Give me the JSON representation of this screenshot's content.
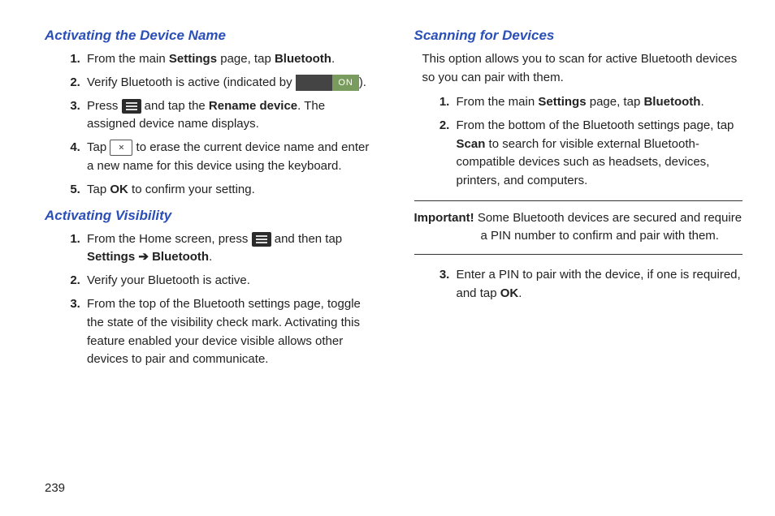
{
  "pageNumber": "239",
  "left": {
    "section1": {
      "title": "Activating the Device Name",
      "steps": [
        {
          "pre": "From the main ",
          "b1": "Settings",
          "mid1": " page, tap ",
          "b2": "Bluetooth",
          "post": "."
        },
        {
          "pre": "Verify Bluetooth is active (indicated by ",
          "post": ")."
        },
        {
          "pre": "Press ",
          "mid1": " and tap the ",
          "b1": "Rename device",
          "post": ". The assigned device name displays."
        },
        {
          "pre": "Tap ",
          "post": " to erase the current device name and enter a new name for this device using the keyboard."
        },
        {
          "pre": "Tap ",
          "b1": "OK",
          "post": " to confirm your setting."
        }
      ]
    },
    "section2": {
      "title": "Activating Visibility",
      "steps": [
        {
          "pre": "From the Home screen, press ",
          "mid1": " and then tap ",
          "b1": "Settings",
          "arrow": " ➔ ",
          "b2": "Bluetooth",
          "post": "."
        },
        {
          "text": "Verify your Bluetooth is active."
        },
        {
          "text": "From the top of the Bluetooth settings page, toggle the state of the visibility check mark. Activating this feature enabled your device visible allows other devices to pair and communicate."
        }
      ]
    }
  },
  "right": {
    "section1": {
      "title": "Scanning for Devices",
      "intro": "This option allows you to scan for active Bluetooth devices so you can pair with them.",
      "stepsA": [
        {
          "pre": "From the main ",
          "b1": "Settings",
          "mid1": " page, tap ",
          "b2": "Bluetooth",
          "post": "."
        },
        {
          "pre": "From the bottom of the Bluetooth settings page, tap ",
          "b1": "Scan",
          "post": " to search for visible external Bluetooth-compatible devices such as headsets, devices, printers, and computers."
        }
      ],
      "important": {
        "label": "Important!",
        "text": " Some Bluetooth devices are secured and require a PIN number to confirm and pair with them."
      },
      "stepsB": [
        {
          "pre": "Enter a PIN to pair with the device, if one is required, and tap ",
          "b1": "OK",
          "post": "."
        }
      ]
    }
  }
}
